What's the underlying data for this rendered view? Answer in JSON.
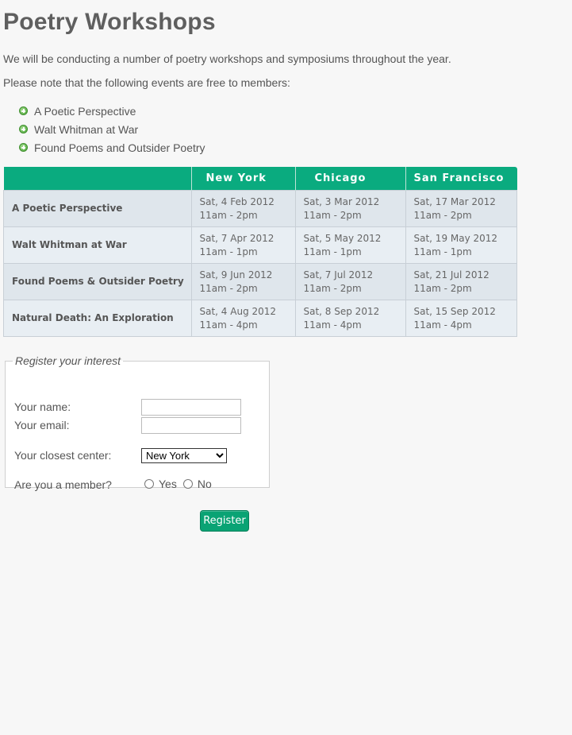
{
  "page": {
    "title": "Poetry Workshops",
    "intro_1": "We will be conducting a number of poetry workshops and symposiums throughout the year.",
    "intro_2": "Please note that the following events are free to members:"
  },
  "free_events": [
    {
      "label": "A Poetic Perspective",
      "icon": "plus-circle-icon"
    },
    {
      "label": "Walt Whitman at War",
      "icon": "plus-circle-icon"
    },
    {
      "label": "Found Poems and Outsider Poetry",
      "icon": "plus-circle-icon"
    }
  ],
  "schedule": {
    "columns": [
      "",
      "New York",
      "Chicago",
      "San Francisco"
    ],
    "rows": [
      {
        "event": "A Poetic Perspective",
        "cells": [
          [
            "Sat, 4 Feb 2012",
            "11am - 2pm"
          ],
          [
            "Sat, 3 Mar 2012",
            "11am - 2pm"
          ],
          [
            "Sat, 17 Mar 2012",
            "11am - 2pm"
          ]
        ]
      },
      {
        "event": "Walt Whitman at War",
        "cells": [
          [
            "Sat, 7 Apr 2012",
            "11am - 1pm"
          ],
          [
            "Sat, 5 May 2012",
            "11am - 1pm"
          ],
          [
            "Sat, 19 May 2012",
            "11am - 1pm"
          ]
        ]
      },
      {
        "event": "Found Poems & Outsider Poetry",
        "cells": [
          [
            "Sat, 9 Jun 2012",
            "11am - 2pm"
          ],
          [
            "Sat, 7 Jul 2012",
            "11am - 2pm"
          ],
          [
            "Sat, 21 Jul 2012",
            "11am - 2pm"
          ]
        ]
      },
      {
        "event": "Natural Death: An Exploration",
        "cells": [
          [
            "Sat, 4 Aug 2012",
            "11am - 4pm"
          ],
          [
            "Sat, 8 Sep 2012",
            "11am - 4pm"
          ],
          [
            "Sat, 15 Sep 2012",
            "11am - 4pm"
          ]
        ]
      }
    ]
  },
  "form": {
    "legend": "Register your interest",
    "name_label": "Your name:",
    "name_value": "",
    "email_label": "Your email:",
    "email_value": "",
    "center_label": "Your closest center:",
    "center_selected": "New York",
    "member_label": "Are you a member?",
    "member_yes": "Yes",
    "member_no": "No",
    "submit_label": "Register"
  },
  "colors": {
    "accent": "#0aab7f",
    "button": "#0aa374",
    "row_odd": "#dfe6ec",
    "row_even": "#e8eef3"
  }
}
